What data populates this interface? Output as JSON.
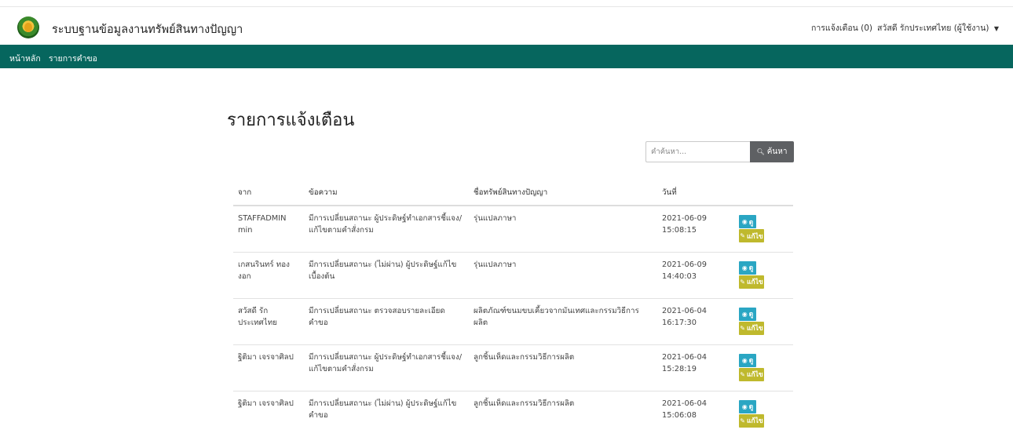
{
  "header": {
    "brand": "ระบบฐานข้อมูลงานทรัพย์สินทางปัญญา",
    "notifications": "การแจ้งเตือน (0)",
    "user": "สวัสดี รักประเทศไทย (ผู้ใช้งาน)"
  },
  "nav": {
    "home": "หน้าหลัก",
    "requests": "รายการคำขอ"
  },
  "page": {
    "title": "รายการแจ้งเตือน"
  },
  "search": {
    "placeholder": "คำค้นหา...",
    "button": "ค้นหา"
  },
  "table": {
    "headers": [
      "จาก",
      "ข้อความ",
      "ชื่อทรัพย์สินทางปัญญา",
      "วันที่"
    ],
    "view_label": "ดู",
    "edit_label": "แก้ไข",
    "rows": [
      {
        "from": "STAFFADMIN min",
        "message": "มีการเปลี่ยนสถานะ ผู้ประดิษฐ์ทำเอกสารชี้แจง/แก้ไขตามคำสั่งกรม",
        "ip": "รุ่นแปลภาษา",
        "date": "2021-06-09",
        "time": "15:08:15"
      },
      {
        "from": "เกสนรินทร์ ทองงอก",
        "message": "มีการเปลี่ยนสถานะ (ไม่ผ่าน) ผู้ประดิษฐ์แก้ไขเบื้องต้น",
        "ip": "รุ่นแปลภาษา",
        "date": "2021-06-09",
        "time": "14:40:03"
      },
      {
        "from": "สวัสดี รักประเทศไทย",
        "message": "มีการเปลี่ยนสถานะ ตรวจสอบรายละเอียดคำขอ",
        "ip": "ผลิตภัณฑ์ขนมขบเคี้ยวจากมันเทศและกรรมวิธีการผลิต",
        "date": "2021-06-04",
        "time": "16:17:30"
      },
      {
        "from": "ฐิติมา เจรจาศิลป",
        "message": "มีการเปลี่ยนสถานะ ผู้ประดิษฐ์ทำเอกสารชี้แจง/แก้ไขตามคำสั่งกรม",
        "ip": "ลูกชิ้นเห็ดและกรรมวิธีการผลิต",
        "date": "2021-06-04",
        "time": "15:28:19"
      },
      {
        "from": "ฐิติมา เจรจาศิลป",
        "message": "มีการเปลี่ยนสถานะ (ไม่ผ่าน) ผู้ประดิษฐ์แก้ไขคำขอ",
        "ip": "ลูกชิ้นเห็ดและกรรมวิธีการผลิต",
        "date": "2021-06-04",
        "time": "15:06:08"
      }
    ]
  }
}
